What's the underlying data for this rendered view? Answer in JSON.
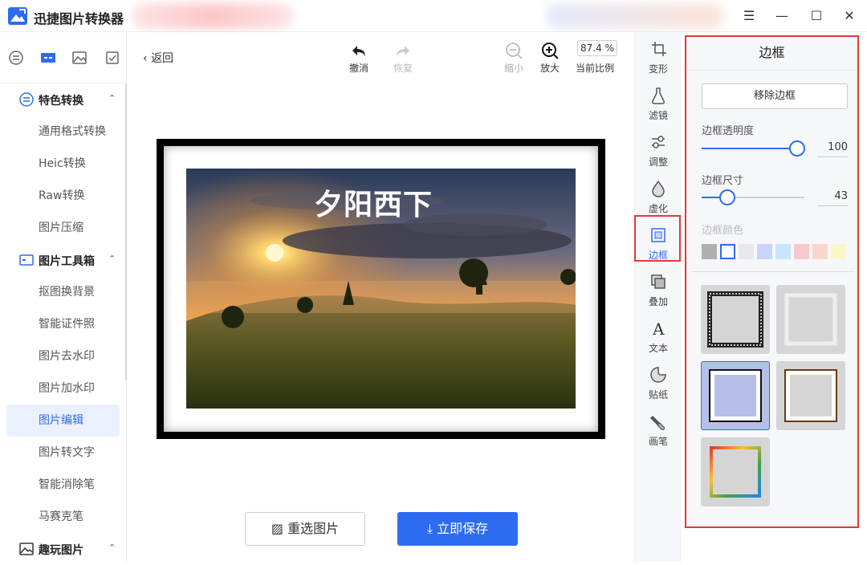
{
  "app": {
    "title": "迅捷图片转换器"
  },
  "window": {
    "menu": "☰",
    "minimize": "—",
    "maximize": "☐",
    "close": "✕"
  },
  "sidebar": {
    "groups": [
      {
        "label": "特色转换",
        "caret": "⌃",
        "items": [
          "通用格式转换",
          "Heic转换",
          "Raw转换",
          "图片压缩"
        ]
      },
      {
        "label": "图片工具箱",
        "caret": "⌃",
        "items": [
          "抠图换背景",
          "智能证件照",
          "图片去水印",
          "图片加水印",
          "图片编辑",
          "图片转文字",
          "智能消除笔",
          "马赛克笔"
        ]
      },
      {
        "label": "趣玩图片",
        "caret": "⌃"
      }
    ],
    "active_item": "图片编辑"
  },
  "toolbar": {
    "back": "返回",
    "undo": "撤消",
    "redo": "恢复",
    "zoom_out": "缩小",
    "zoom_in": "放大",
    "zoom_value": "87.4 %",
    "zoom_label": "当前比例"
  },
  "canvas": {
    "photo_text": "夕阳西下"
  },
  "actions": {
    "reselect": "重选图片",
    "save": "立即保存"
  },
  "tools": [
    "变形",
    "滤镜",
    "调整",
    "虚化",
    "边框",
    "叠加",
    "文本",
    "贴纸",
    "画笔"
  ],
  "active_tool": "边框",
  "panel": {
    "title": "边框",
    "remove_button": "移除边框",
    "opacity_label": "边框透明度",
    "opacity_value": "100",
    "size_label": "边框尺寸",
    "size_value": "43",
    "color_label": "边框颜色",
    "colors": [
      "#b0b0b0",
      "#ffffff",
      "#e8e8ec",
      "#c9d3fb",
      "#c7e6fb",
      "#f7c9cc",
      "#f9d6cb",
      "#fbf6c8"
    ]
  },
  "colors": {
    "accent": "#2d6cf0",
    "highlight": "#e53935",
    "active_bg": "#eaf0fd"
  }
}
